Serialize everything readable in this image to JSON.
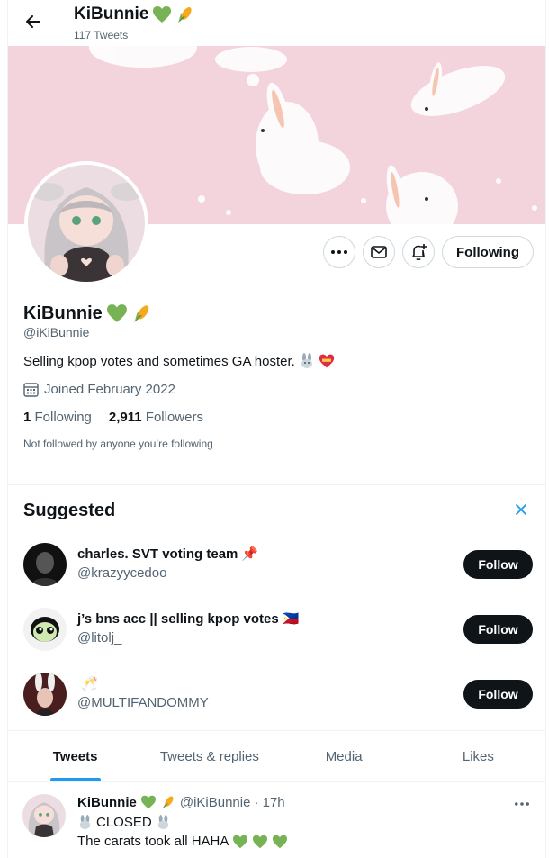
{
  "header": {
    "name": "KiBunnie",
    "tweet_count": "117 Tweets",
    "back_icon": "arrow-left-icon"
  },
  "profile": {
    "name": "KiBunnie",
    "handle": "@iKiBunnie",
    "bio": "Selling kpop votes and sometimes GA hoster.",
    "joined": "Joined February 2022",
    "following_count": "1",
    "following_label": "Following",
    "followers_count": "2,911",
    "followers_label": "Followers",
    "not_followed": "Not followed by anyone you’re following",
    "following_button": "Following",
    "colors": {
      "banner": "#f3d3dc",
      "accent": "#1d9bf0",
      "text": "#0f1419",
      "muted": "#536471"
    }
  },
  "suggested": {
    "title": "Suggested",
    "items": [
      {
        "name": "charles. SVT voting team",
        "handle": "@krazyycedoo",
        "button": "Follow",
        "emoji": "📌"
      },
      {
        "name": "j’s bns acc || selling kpop votes",
        "handle": "@litolj_",
        "button": "Follow",
        "emoji": "🇵🇭"
      },
      {
        "name": "",
        "handle": "@MULTIFANDOMMY_",
        "button": "Follow",
        "emoji": "🥂"
      }
    ]
  },
  "tabs": [
    {
      "label": "Tweets",
      "active": true
    },
    {
      "label": "Tweets & replies",
      "active": false
    },
    {
      "label": "Media",
      "active": false
    },
    {
      "label": "Likes",
      "active": false
    }
  ],
  "tweet": {
    "name": "KiBunnie",
    "handle": "@iKiBunnie",
    "time": "· 17h",
    "line1": "CLOSED",
    "line2": "The carats took all HAHA"
  }
}
